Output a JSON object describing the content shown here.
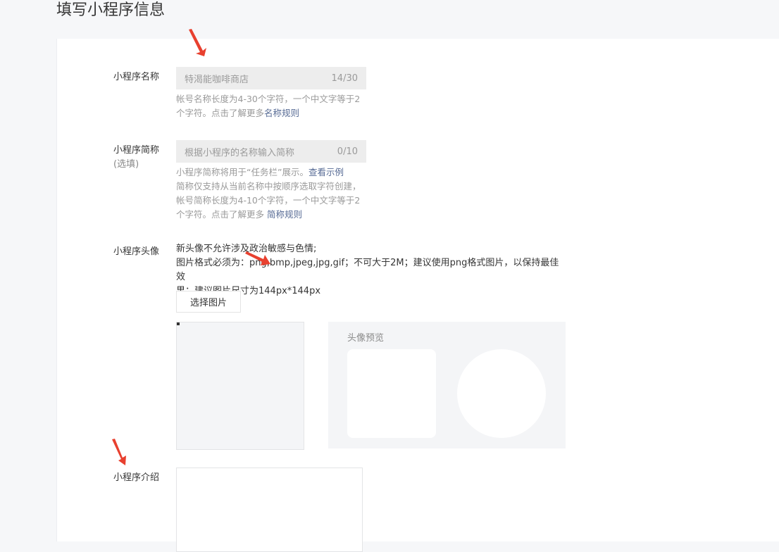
{
  "page": {
    "title": "填写小程序信息"
  },
  "form": {
    "name": {
      "label": "小程序名称",
      "value": "特渴能咖啡商店",
      "counter": "14/30",
      "help_line1": "帐号名称长度为4-30个字符，一个中文字等于2",
      "help_line2": "个字符。点击了解更多",
      "help_link": "名称规则"
    },
    "short_name": {
      "label": "小程序简称",
      "label_sub": "(选填)",
      "placeholder": "根据小程序的名称输入简称",
      "counter": "0/10",
      "help_line1": "小程序简称将用于“任务栏”展示。",
      "help_link1": "查看示例",
      "help_line2": "简称仅支持从当前名称中按顺序选取字符创建，",
      "help_line3": "帐号简称长度为4-10个字符，一个中文字等于2",
      "help_line4": "个字符。点击了解更多 ",
      "help_link2": "简称规则"
    },
    "avatar": {
      "label": "小程序头像",
      "desc_line1": "新头像不允许涉及政治敏感与色情;",
      "desc_line2": "图片格式必须为：png,bmp,jpeg,jpg,gif；不可大于2M；建议使用png格式图片，以保持最佳效",
      "desc_line3": "果；建议图片尺寸为144px*144px",
      "button_label": "选择图片",
      "preview_title": "头像预览"
    },
    "intro": {
      "label": "小程序介绍"
    }
  },
  "colors": {
    "link": "#576b95",
    "annotation_arrow": "#e8402f"
  }
}
